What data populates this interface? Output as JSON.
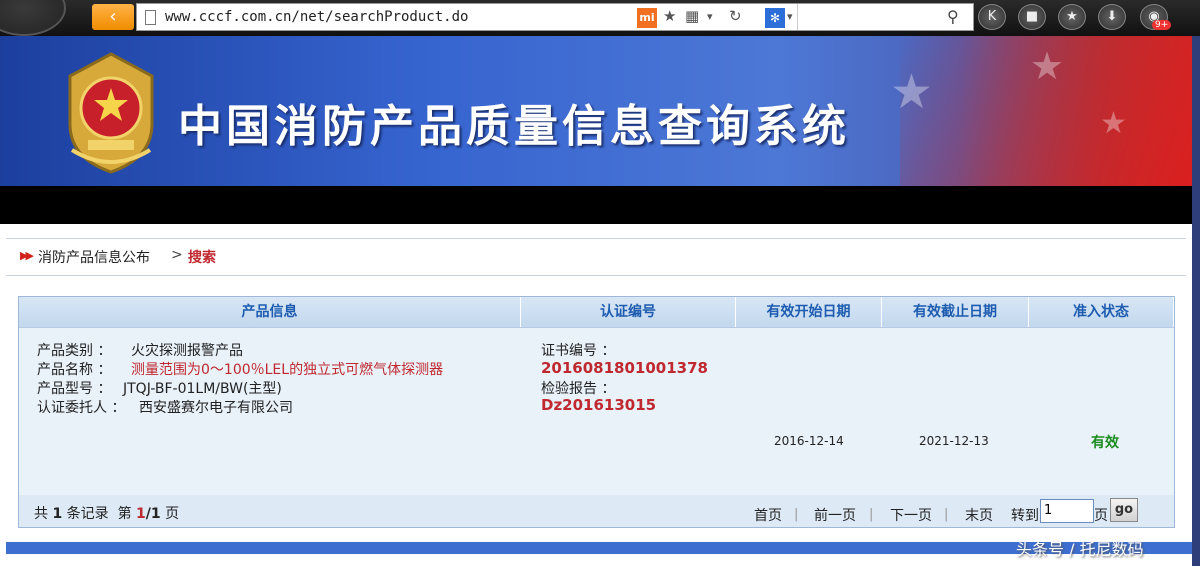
{
  "browser": {
    "url": "www.cccf.com.cn/net/searchProduct.do",
    "back_icon": "back-arrow-icon",
    "extension_badge": "9+",
    "toolbar_buttons": [
      "k-icon",
      "lock-icon",
      "star-icon",
      "download-icon",
      "game-controller-icon"
    ]
  },
  "banner": {
    "title": "中国消防产品质量信息查询系统"
  },
  "breadcrumb": {
    "home": "消防产品信息公布",
    "separator": ">",
    "current": "搜索"
  },
  "table": {
    "headers": [
      "产品信息",
      "认证编号",
      "有效开始日期",
      "有效截止日期",
      "准入状态"
    ],
    "row": {
      "category_label": "产品类别 ：",
      "category_value": "火灾探测报警产品",
      "name_label": "产品名称 ：",
      "name_value": "测量范围为0～100％LEL的独立式可燃气体探测器",
      "model_label": "产品型号 ：",
      "model_value": "JTQJ-BF-01LM/BW(主型)",
      "client_label": "认证委托人 ：",
      "client_value": "西安盛赛尔电子有限公司",
      "cert_label": "证书编号 ：",
      "cert_value": "2016081801001378",
      "report_label": "检验报告 ：",
      "report_value": "Dz201613015",
      "start_date": "2016-12-14",
      "end_date": "2021-12-13",
      "status": "有效"
    }
  },
  "pager": {
    "prefix": "共",
    "total": "1",
    "records_word": "条记录",
    "page_word": "第",
    "current_page": "1",
    "slash": "/",
    "total_pages": "1",
    "page_suffix": "页",
    "first": "首页",
    "prev": "前一页",
    "next": "下一页",
    "last": "末页",
    "goto_label": "转到",
    "goto_value": "1",
    "goto_unit": "页",
    "go": "go"
  },
  "watermark": "头条号 / 托尼数码",
  "colors": {
    "banner_blue": "#3664cf",
    "accent_red": "#c0282f",
    "header_blue": "#1d5cb0",
    "status_green": "#1b8c1e"
  }
}
